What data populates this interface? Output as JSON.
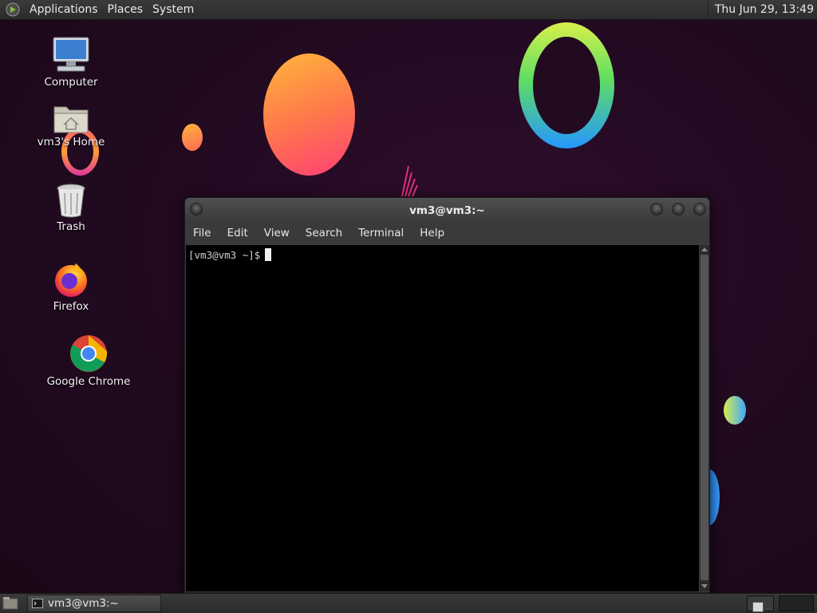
{
  "top_panel": {
    "menus": [
      "Applications",
      "Places",
      "System"
    ],
    "clock": "Thu Jun 29, 13:49",
    "logo_icon": "distro-logo-icon"
  },
  "desktop_icons": [
    {
      "label": "Computer",
      "icon": "computer-icon"
    },
    {
      "label": "vm3's Home",
      "icon": "home-folder-icon"
    },
    {
      "label": "Trash",
      "icon": "trash-icon"
    },
    {
      "label": "Firefox",
      "icon": "firefox-icon"
    },
    {
      "label": "Google Chrome",
      "icon": "chrome-icon"
    }
  ],
  "terminal": {
    "title": "vm3@vm3:~",
    "menus": [
      "File",
      "Edit",
      "View",
      "Search",
      "Terminal",
      "Help"
    ],
    "prompt": "[vm3@vm3 ~]$"
  },
  "taskbar": {
    "task_label": "vm3@vm3:~"
  },
  "colors": {
    "panel": "#2f2f2f",
    "desktop_bg": "#220a21",
    "terminal_bg": "#000000"
  }
}
